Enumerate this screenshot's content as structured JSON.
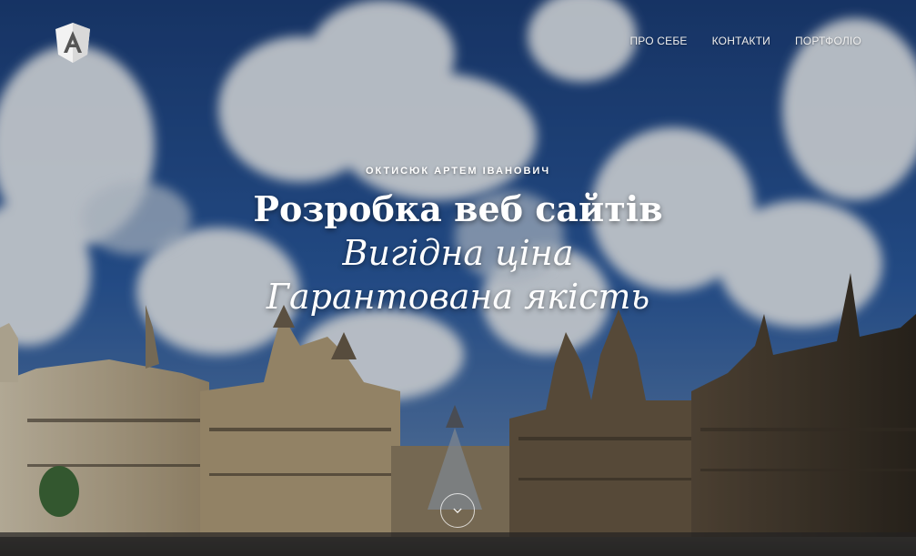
{
  "brand": {
    "logo_letter": "A",
    "logo_icon": "angular-shield-icon"
  },
  "nav": {
    "items": [
      {
        "label": "ПРО СЕБЕ"
      },
      {
        "label": "КОНТАКТИ"
      },
      {
        "label": "ПОРТФОЛІО"
      }
    ]
  },
  "hero": {
    "subtitle": "ОКТИСЮК АРТЕМ ІВАНОВИЧ",
    "line1": "Розробка веб сайтів",
    "line2": "Вигідна ціна",
    "line3": "Гарантована якість",
    "scroll_icon": "chevron-down-icon",
    "background": "louvre-palace-sky-photo"
  },
  "colors": {
    "sky": "#1f4f93",
    "cloud": "#e8eef5",
    "stone": "#b9a98a",
    "text": "#ffffff"
  }
}
